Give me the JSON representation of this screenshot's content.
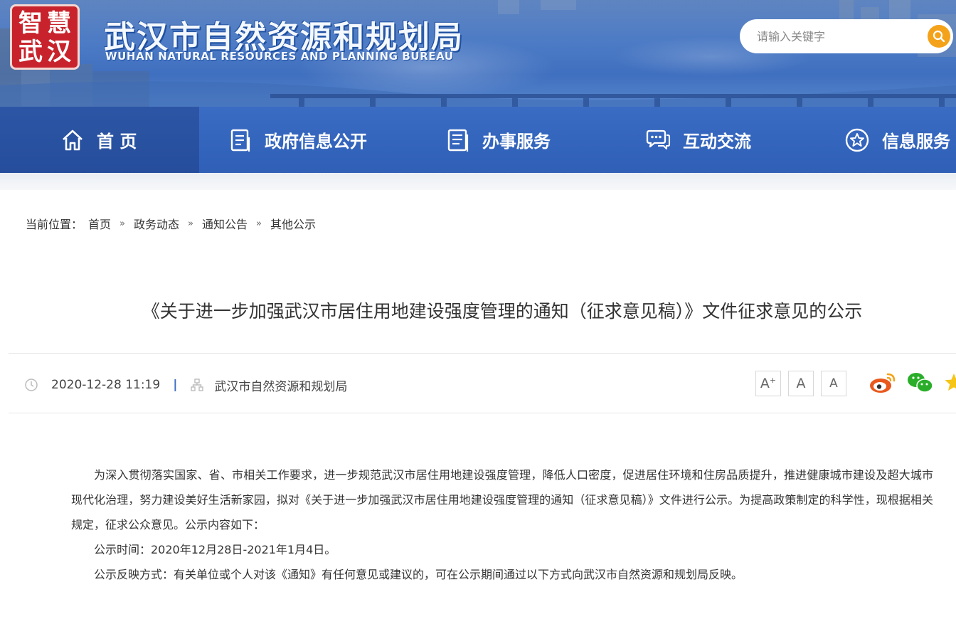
{
  "header": {
    "logo_chars": [
      "智",
      "慧",
      "武",
      "汉"
    ],
    "title": "武汉市自然资源和规划局",
    "subtitle": "WUHAN NATURAL RESOURCES AND PLANNING BUREAU",
    "search_placeholder": "请输入关键字",
    "search_icon": "search-icon"
  },
  "nav": {
    "items": [
      {
        "label": "首 页",
        "icon": "home-icon",
        "active": true
      },
      {
        "label": "政府信息公开",
        "icon": "document-icon"
      },
      {
        "label": "办事服务",
        "icon": "service-icon"
      },
      {
        "label": "互动交流",
        "icon": "chat-icon"
      },
      {
        "label": "信息服务",
        "icon": "star-icon"
      }
    ]
  },
  "breadcrumb": {
    "prefix": "当前位置：",
    "items": [
      "首页",
      "政务动态",
      "通知公告",
      "其他公示"
    ],
    "separator": "»"
  },
  "article": {
    "title": "《关于进一步加强武汉市居住用地建设强度管理的通知（征求意见稿）》文件征求意见的公示",
    "date": "2020-12-28 11:19",
    "source": "武汉市自然资源和规划局",
    "font_sizes": [
      "A",
      "A",
      "A"
    ],
    "share_icons": [
      "weibo-icon",
      "wechat-icon",
      "favorite-icon"
    ],
    "paragraphs": [
      "为深入贯彻落实国家、省、市相关工作要求，进一步规范武汉市居住用地建设强度管理，降低人口密度，促进居住环境和住房品质提升，推进健康城市建设及超大城市现代化治理，努力建设美好生活新家园，拟对《关于进一步加强武汉市居住用地建设强度管理的通知（征求意见稿）》文件进行公示。为提高政策制定的科学性，现根据相关规定，征求公众意见。公示内容如下：",
      "公示时间：2020年12月28日-2021年1月4日。",
      "公示反映方式：有关单位或个人对该《通知》有任何意见或建议的，可在公示期间通过以下方式向武汉市自然资源和规划局反映。"
    ]
  },
  "colors": {
    "nav_bg": "#2f5fb6",
    "logo_red": "#c8232c",
    "search_orange": "#f4a21a",
    "weibo_orange": "#e8591e",
    "wechat_green": "#2aae2a"
  }
}
